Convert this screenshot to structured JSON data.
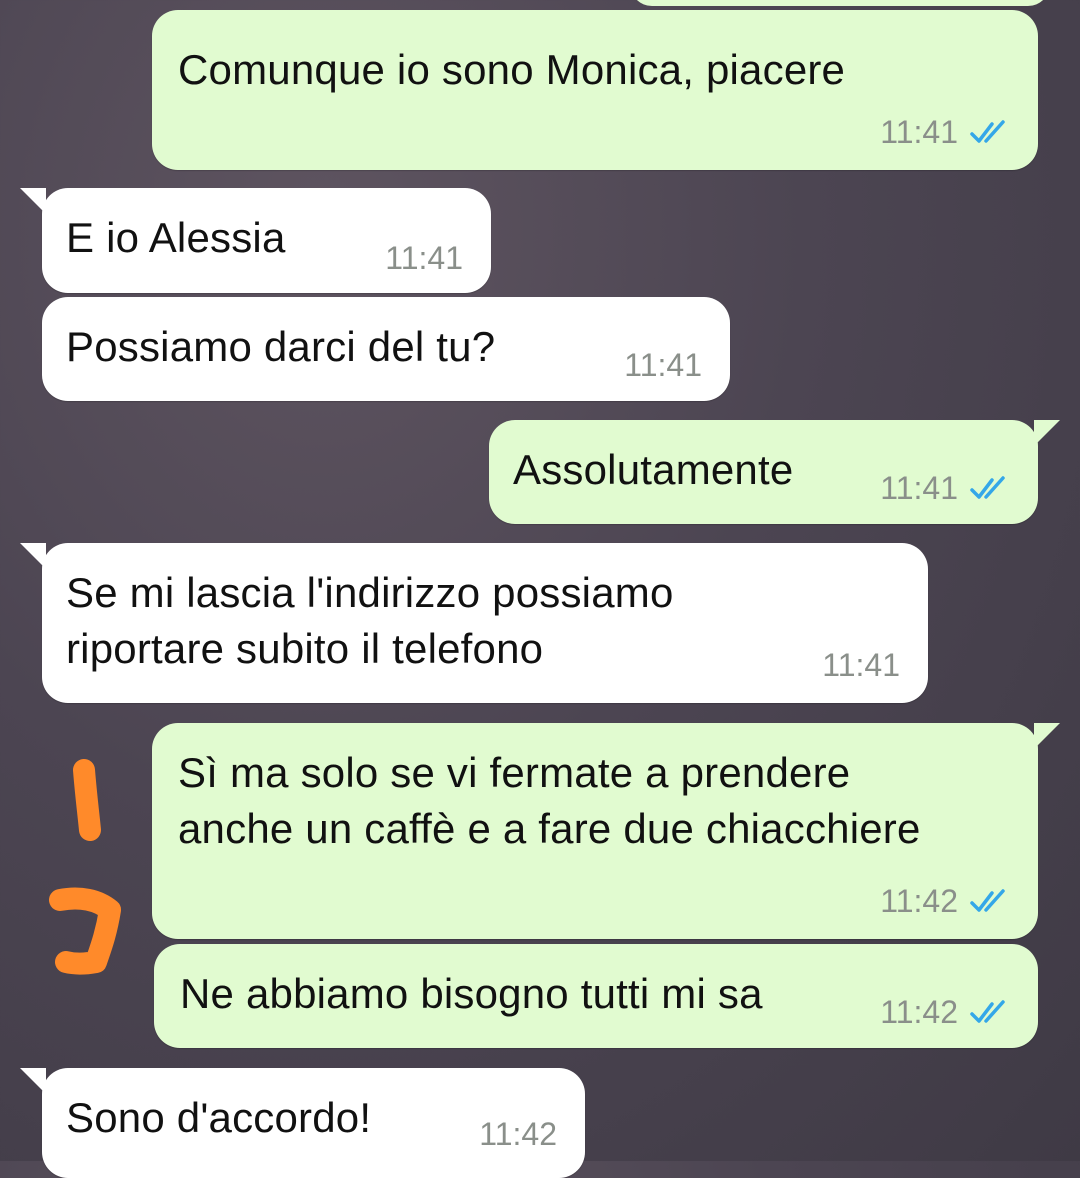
{
  "colors": {
    "outgoing_bubble": "#e1fbd0",
    "incoming_bubble": "#ffffff",
    "read_ticks": "#34a7e8",
    "annotation": "#ff8a2a"
  },
  "annotations": {
    "markers": [
      "1",
      "2"
    ],
    "icon": "orange-handwritten-number"
  },
  "messages": [
    {
      "direction": "out",
      "text": "Comunque io sono Monica, piacere",
      "time": "11:41",
      "status_icon": "double-check-icon"
    },
    {
      "direction": "in",
      "text": "E io Alessia",
      "time": "11:41"
    },
    {
      "direction": "in",
      "text": "Possiamo darci del tu?",
      "time": "11:41"
    },
    {
      "direction": "out",
      "text": "Assolutamente",
      "time": "11:41",
      "status_icon": "double-check-icon"
    },
    {
      "direction": "in",
      "text": "Se mi lascia l'indirizzo possiamo\nriportare subito il telefono",
      "time": "11:41"
    },
    {
      "direction": "out",
      "text": "Sì ma solo se vi fermate a prendere\nanche un caffè e a fare due chiacchiere",
      "time": "11:42",
      "status_icon": "double-check-icon"
    },
    {
      "direction": "out",
      "text": "Ne abbiamo bisogno tutti mi sa",
      "time": "11:42",
      "status_icon": "double-check-icon"
    },
    {
      "direction": "in",
      "text": "Sono d'accordo!",
      "time": "11:42"
    }
  ]
}
